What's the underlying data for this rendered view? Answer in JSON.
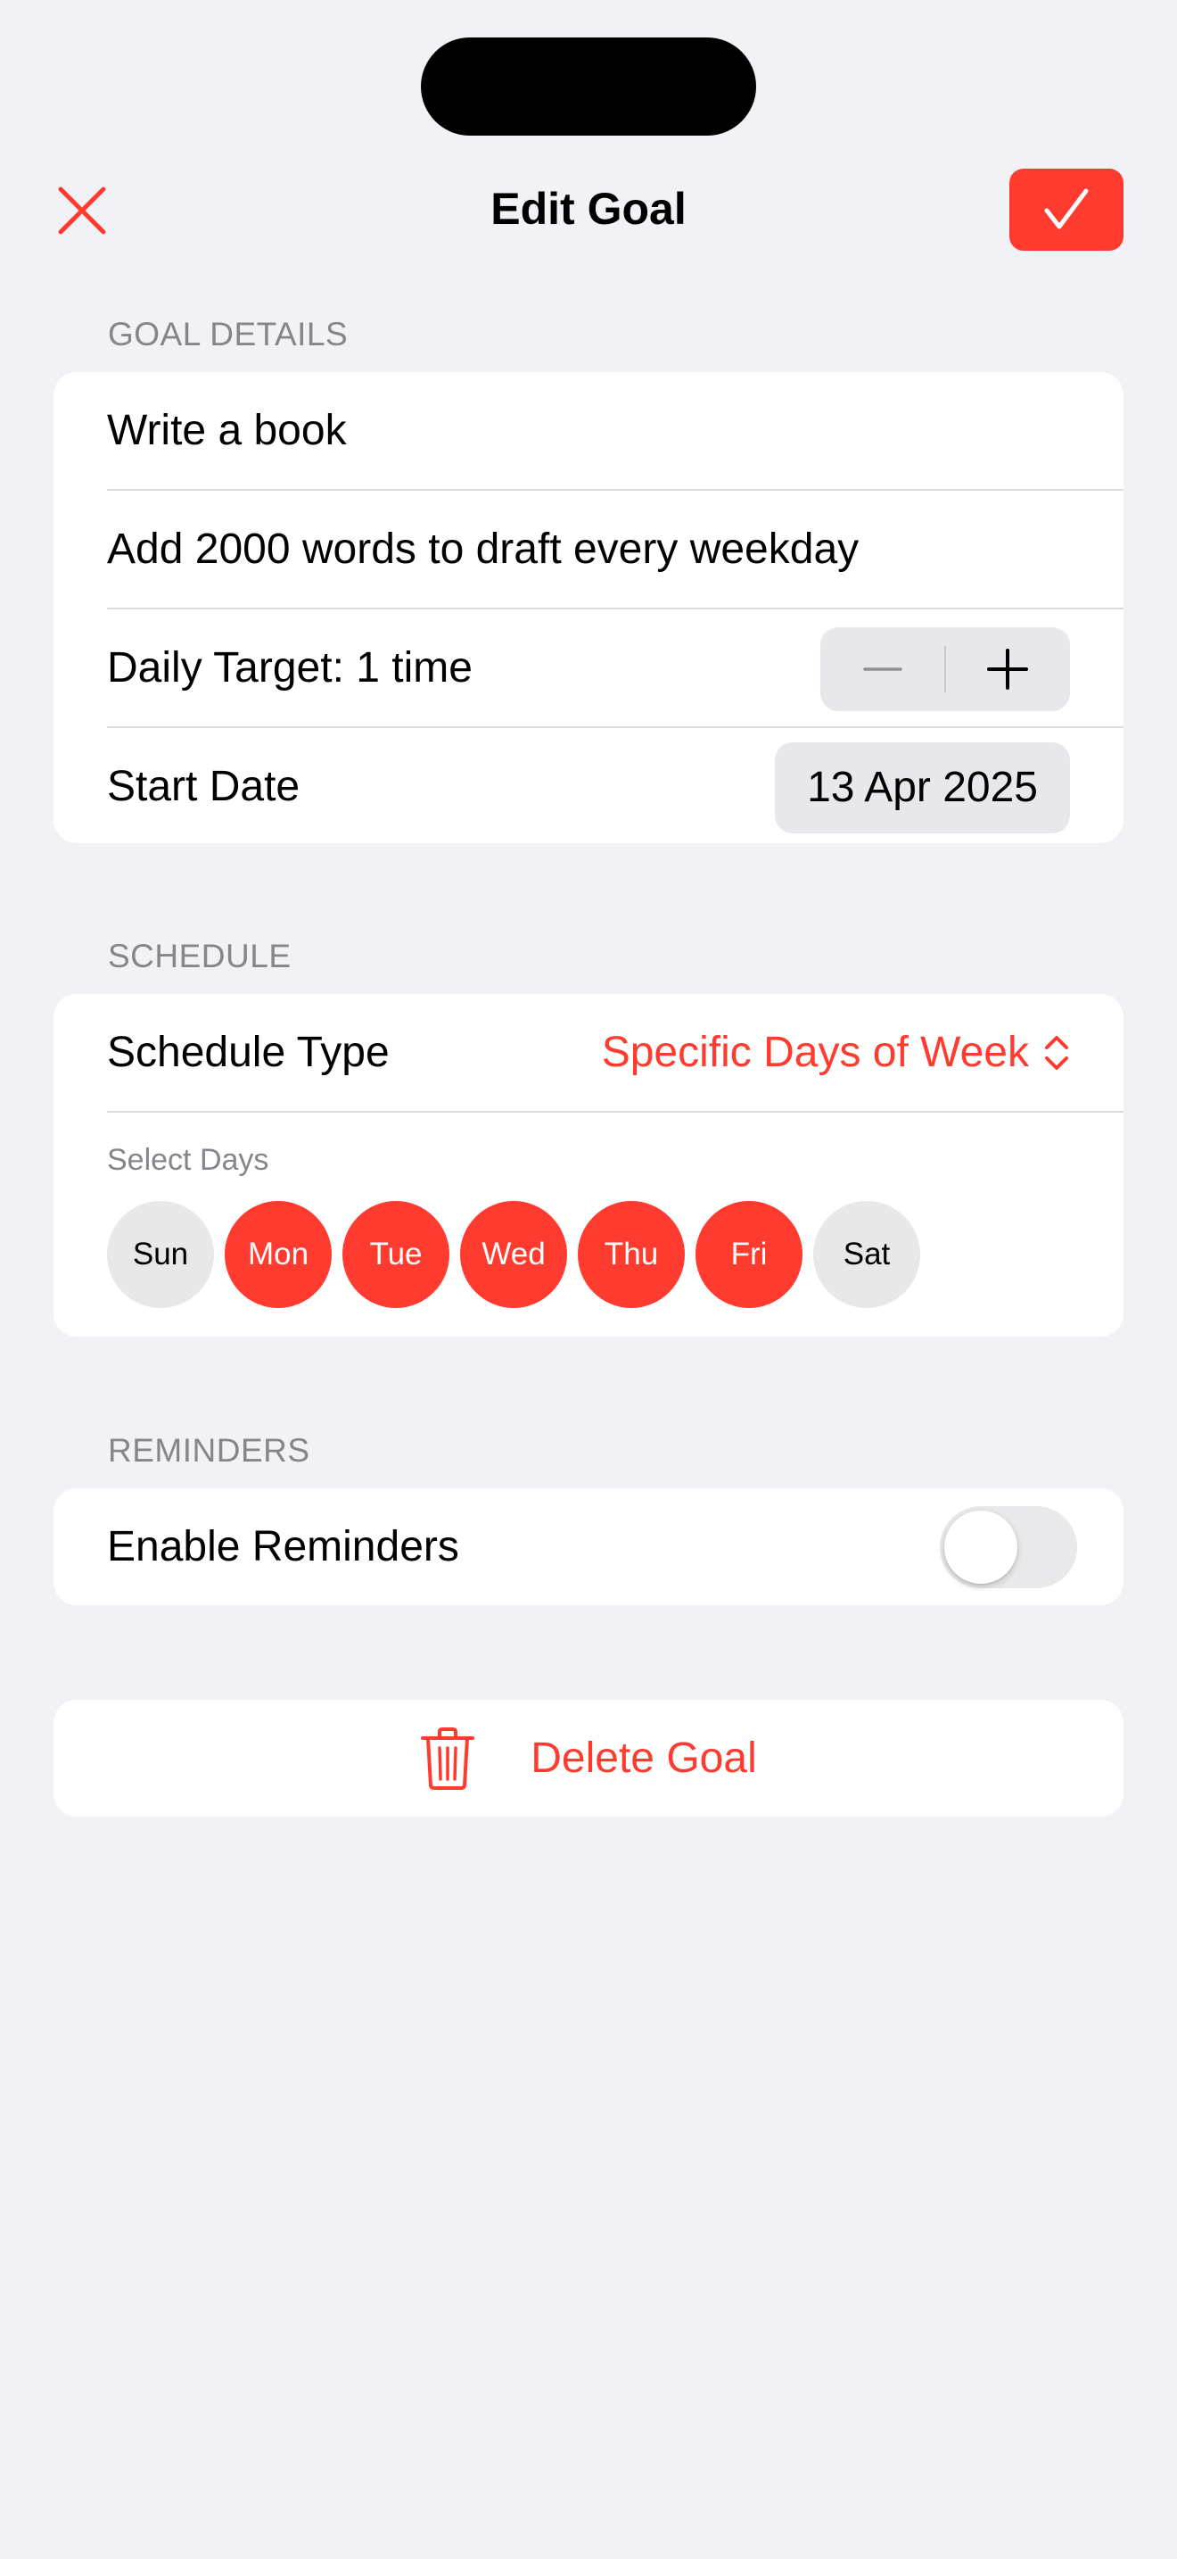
{
  "nav": {
    "title": "Edit Goal",
    "close_icon": "close-icon",
    "save_icon": "checkmark-icon"
  },
  "goal_details": {
    "header": "GOAL DETAILS",
    "title_value": "Write a book",
    "description_value": "Add 2000 words to draft every weekday",
    "daily_target_label": "Daily Target: 1 time",
    "start_date_label": "Start Date",
    "start_date_value": "13 Apr 2025"
  },
  "schedule": {
    "header": "SCHEDULE",
    "type_label": "Schedule Type",
    "type_value": "Specific Days of Week",
    "select_days_label": "Select Days",
    "days": [
      {
        "label": "Sun",
        "selected": false
      },
      {
        "label": "Mon",
        "selected": true
      },
      {
        "label": "Tue",
        "selected": true
      },
      {
        "label": "Wed",
        "selected": true
      },
      {
        "label": "Thu",
        "selected": true
      },
      {
        "label": "Fri",
        "selected": true
      },
      {
        "label": "Sat",
        "selected": false
      }
    ]
  },
  "reminders": {
    "header": "REMINDERS",
    "enable_label": "Enable Reminders",
    "enabled": false
  },
  "delete": {
    "label": "Delete Goal",
    "icon": "trash-icon"
  },
  "colors": {
    "accent": "#ff3b30",
    "background": "#f2f1f6",
    "secondary_text": "#86858b"
  }
}
